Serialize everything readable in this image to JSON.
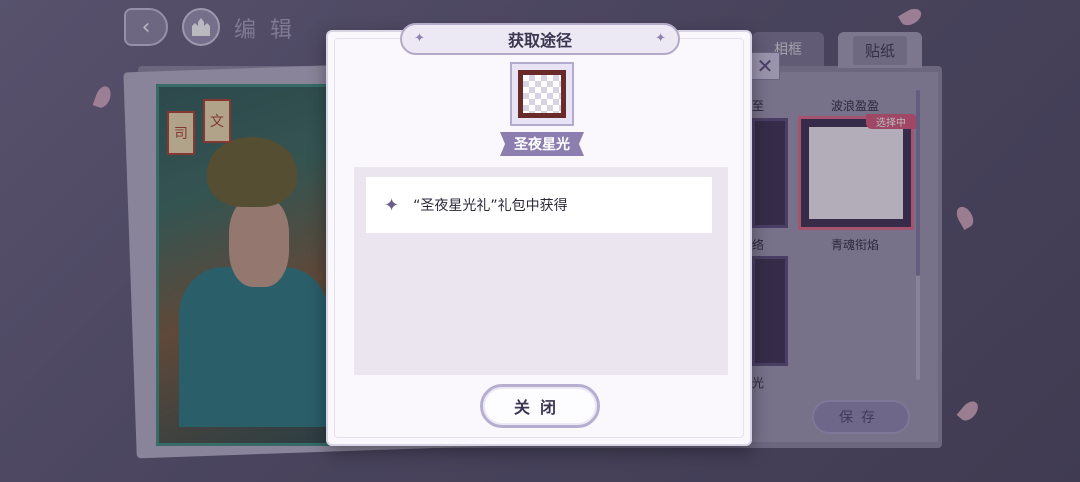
{
  "header": {
    "title": "编辑",
    "back_icon": "back-arrow-icon",
    "home_icon": "castle-icon"
  },
  "tabs": {
    "frame_label": "相框",
    "sticker_label": "贴纸"
  },
  "frames": [
    {
      "label": "波浪盈盈",
      "selected": false
    },
    {
      "label": "青魂衔焰",
      "selected": true,
      "badge": "选择中"
    }
  ],
  "partial_labels": {
    "top_left": "至",
    "mid_left": "络",
    "bottom_left": "光"
  },
  "card": {
    "tiles": [
      "文",
      "司"
    ]
  },
  "save_button": "保存",
  "modal": {
    "title": "获取途径",
    "item_name": "圣夜星光",
    "sources": [
      {
        "text": "“圣夜星光礼”礼包中获得"
      }
    ],
    "close_button": "关闭"
  },
  "colors": {
    "accent": "#8c7fb0",
    "badge": "#d8587a",
    "modal_bg": "#faf8fc"
  }
}
